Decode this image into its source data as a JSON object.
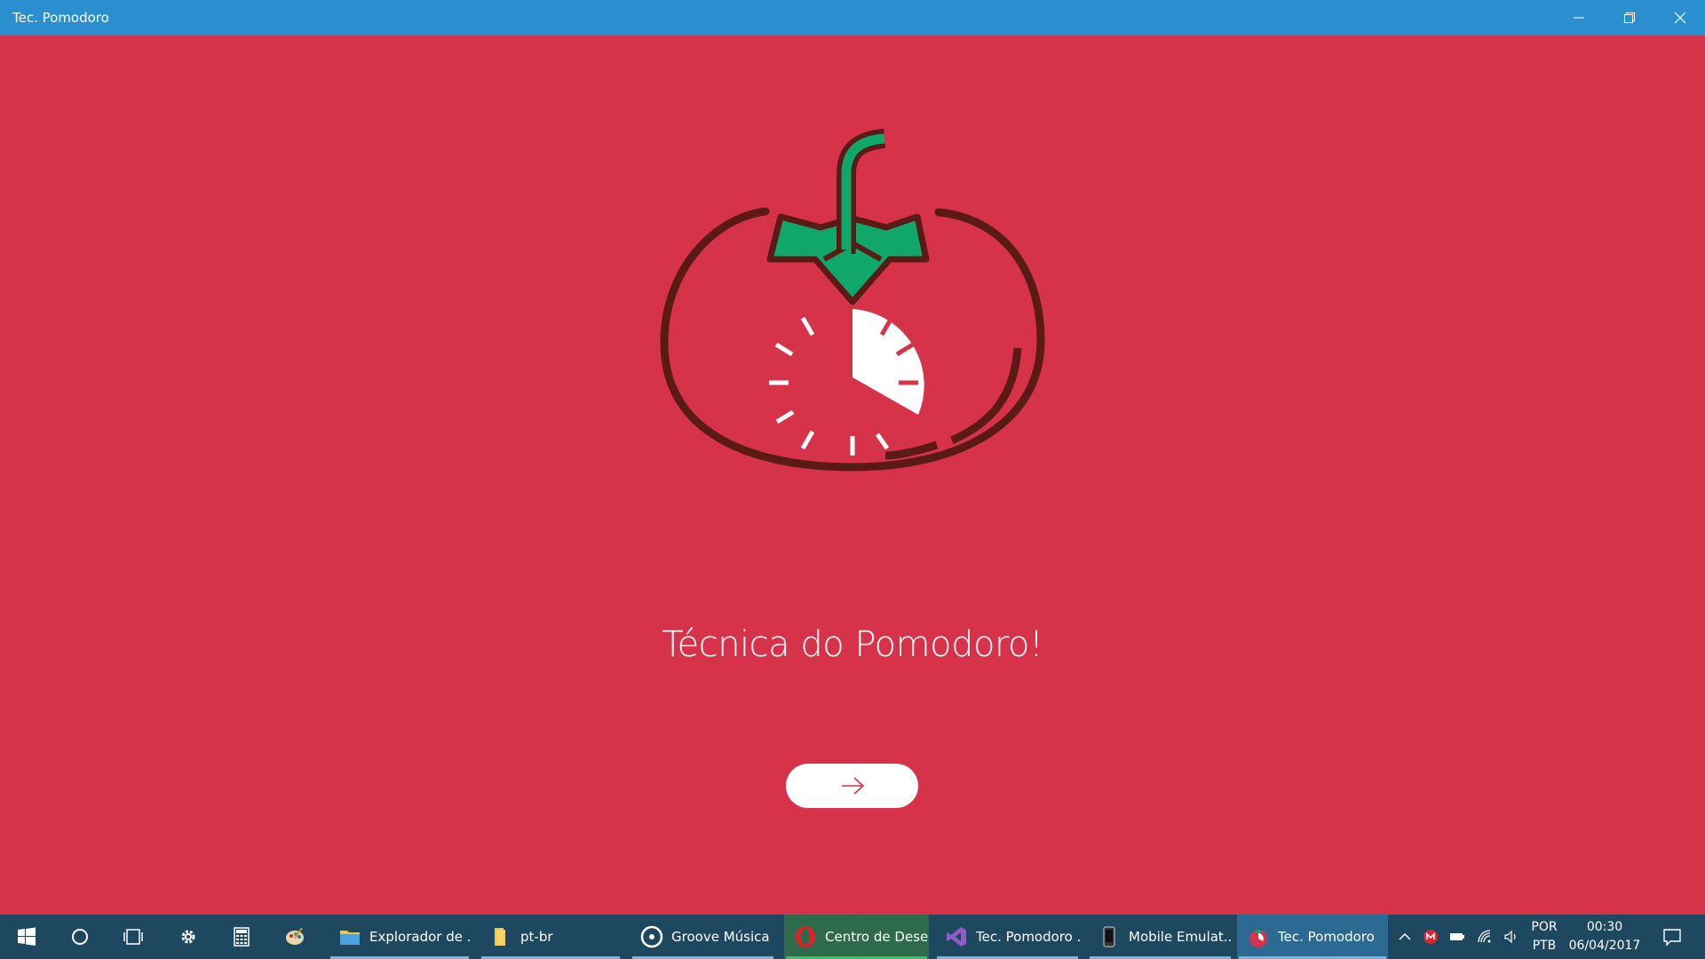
{
  "window": {
    "title": "Tec. Pomodoro",
    "controls": [
      "minimize",
      "restore",
      "close"
    ]
  },
  "colors": {
    "background": "#d6334a",
    "titlebar": "#2b8fcf",
    "tomato_outline": "#5a1a16",
    "leaf": "#0fa86a",
    "taskbar": "#1e4760"
  },
  "main": {
    "logo_icon": "pomodoro-tomato-clock-icon",
    "headline": "Técnica do Pomodoro!",
    "next_button_icon": "arrow-right-icon"
  },
  "taskbar": {
    "pinned": [
      {
        "name": "start-icon"
      },
      {
        "name": "cortana-icon"
      },
      {
        "name": "task-view-icon"
      },
      {
        "name": "settings-icon"
      },
      {
        "name": "calculator-icon"
      },
      {
        "name": "paint-icon"
      }
    ],
    "apps": [
      {
        "label": "Explorador de ...",
        "icon": "folder-icon"
      },
      {
        "label": "pt-br",
        "icon": "folder-icon"
      },
      {
        "label": "Groove Música",
        "icon": "groove-music-icon"
      },
      {
        "label": "Centro de Dese...",
        "icon": "opera-icon"
      },
      {
        "label": "Tec. Pomodoro ...",
        "icon": "visual-studio-icon"
      },
      {
        "label": "Mobile Emulat...",
        "icon": "phone-icon"
      },
      {
        "label": "Tec. Pomodoro",
        "icon": "tomato-icon"
      }
    ],
    "tray": {
      "lang_top": "POR",
      "lang_bottom": "PTB",
      "time": "00:30",
      "date": "06/04/2017"
    }
  }
}
